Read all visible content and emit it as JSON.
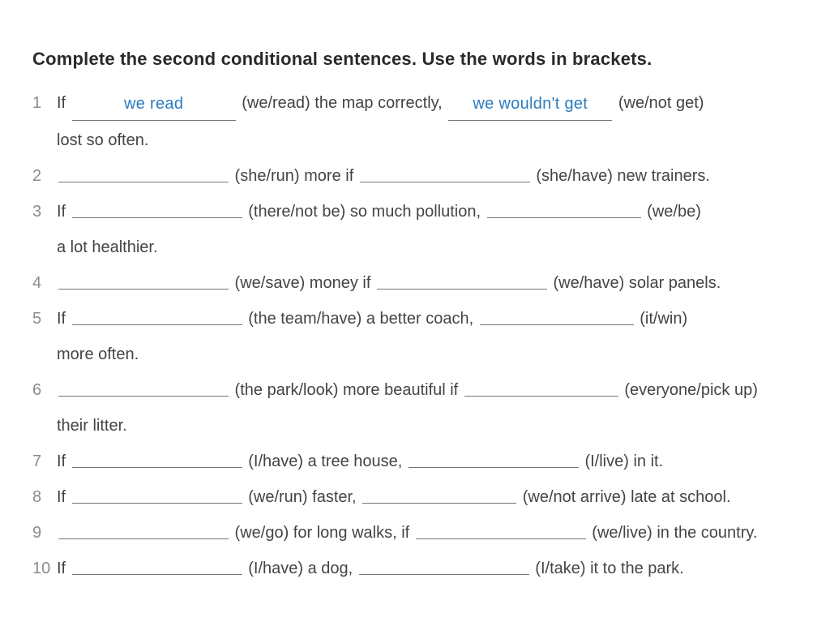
{
  "instruction": "Complete the second conditional sentences. Use the words in brackets.",
  "example_fill": {
    "a": "we read",
    "b": "we wouldn't get"
  },
  "items": [
    {
      "n": "1",
      "pre1": "If ",
      "fill1": "we read",
      "br1": " (we/read) the map correctly, ",
      "fill2": "we wouldn't get",
      "br2": " (we/not get)",
      "cont": "lost so often."
    },
    {
      "n": "2",
      "pre1": "",
      "br1": " (she/run) more if ",
      "br2": " (she/have) new trainers."
    },
    {
      "n": "3",
      "pre1": "If ",
      "br1": " (there/not be) so much pollution, ",
      "br2": " (we/be)",
      "cont": "a lot healthier."
    },
    {
      "n": "4",
      "pre1": "",
      "br1": " (we/save) money if ",
      "br2": " (we/have) solar panels."
    },
    {
      "n": "5",
      "pre1": "If ",
      "br1": " (the team/have) a better coach, ",
      "br2": " (it/win)",
      "cont": "more often."
    },
    {
      "n": "6",
      "pre1": "",
      "br1": " (the park/look) more beautiful if ",
      "br2": " (everyone/pick up)",
      "cont": "their litter."
    },
    {
      "n": "7",
      "pre1": "If ",
      "br1": " (I/have) a tree house, ",
      "br2": " (I/live) in it."
    },
    {
      "n": "8",
      "pre1": "If ",
      "br1": " (we/run) faster, ",
      "br2": " (we/not arrive) late at school."
    },
    {
      "n": "9",
      "pre1": "",
      "br1": " (we/go) for long walks, if ",
      "br2": " (we/live) in the country."
    },
    {
      "n": "10",
      "pre1": "If ",
      "br1": " (I/have) a dog, ",
      "br2": " (I/take) it to the park."
    }
  ]
}
